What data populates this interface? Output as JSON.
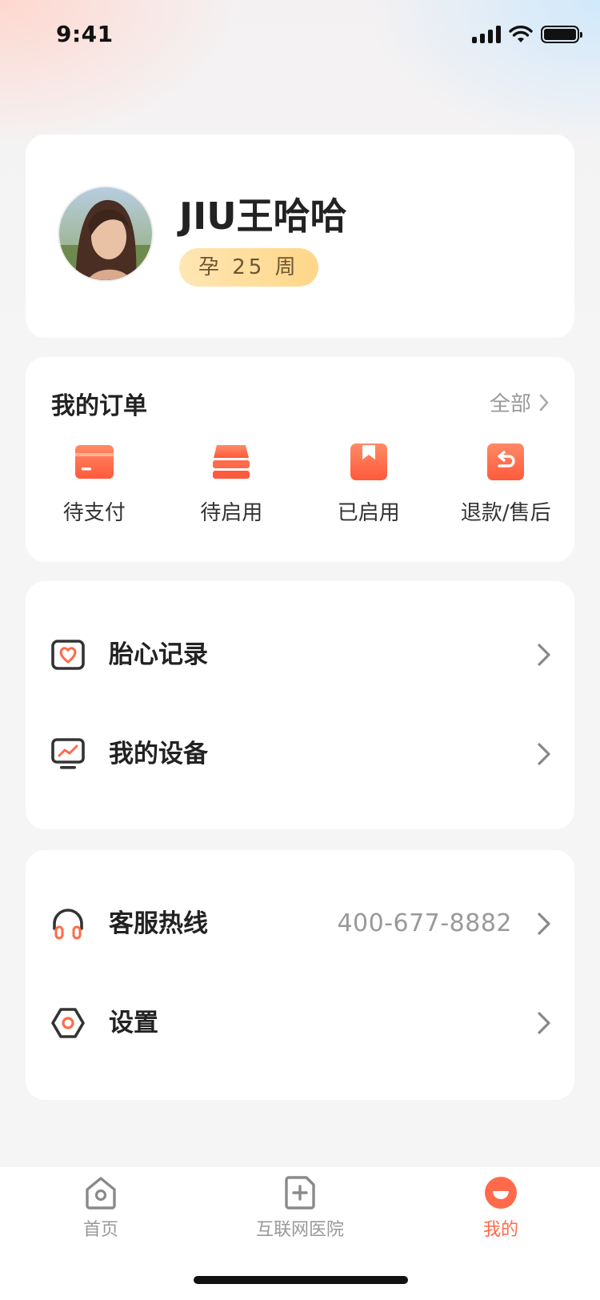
{
  "status_bar": {
    "time": "9:41"
  },
  "profile": {
    "name": "JIU王哈哈",
    "pregnancy_badge": "孕 25 周"
  },
  "orders": {
    "title": "我的订单",
    "all_label": "全部",
    "items": [
      {
        "label": "待支付",
        "icon": "card-icon"
      },
      {
        "label": "待启用",
        "icon": "stack-icon"
      },
      {
        "label": "已启用",
        "icon": "bookmark-icon"
      },
      {
        "label": "退款/售后",
        "icon": "return-icon"
      }
    ]
  },
  "menu1": [
    {
      "label": "胎心记录",
      "icon": "heart-record-icon"
    },
    {
      "label": "我的设备",
      "icon": "monitor-icon"
    }
  ],
  "menu2": [
    {
      "label": "客服热线",
      "value": "400-677-8882",
      "icon": "headset-icon"
    },
    {
      "label": "设置",
      "icon": "settings-icon"
    }
  ],
  "tab_bar": {
    "tabs": [
      {
        "label": "首页",
        "icon": "home-icon",
        "active": false
      },
      {
        "label": "互联网医院",
        "icon": "hospital-icon",
        "active": false
      },
      {
        "label": "我的",
        "icon": "profile-icon",
        "active": true
      }
    ]
  },
  "colors": {
    "accent": "#ff6a4a",
    "badge_start": "#ffe6b3",
    "badge_end": "#ffd689"
  }
}
